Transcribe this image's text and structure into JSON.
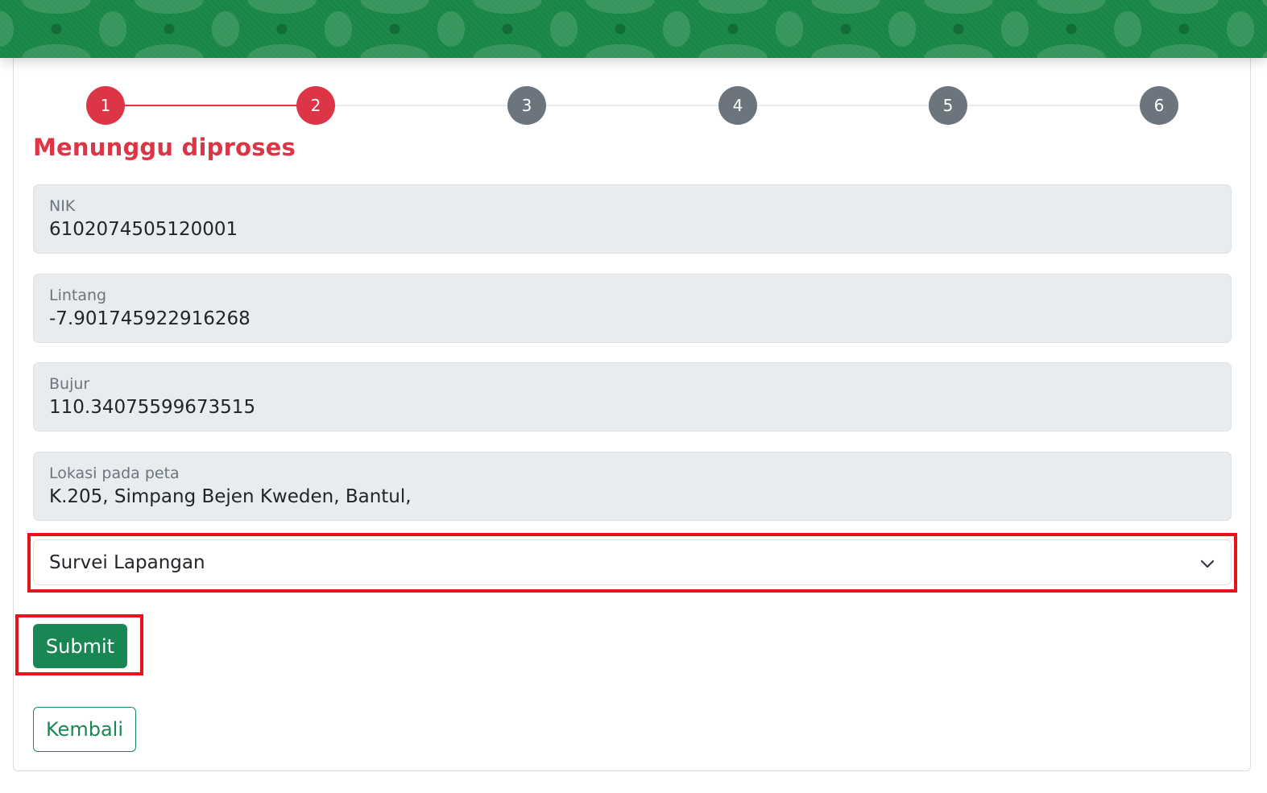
{
  "stepper": {
    "steps": [
      {
        "label": "1",
        "state": "active"
      },
      {
        "label": "2",
        "state": "active"
      },
      {
        "label": "3",
        "state": "inactive"
      },
      {
        "label": "4",
        "state": "inactive"
      },
      {
        "label": "5",
        "state": "inactive"
      },
      {
        "label": "6",
        "state": "inactive"
      }
    ],
    "active_color": "#dc3545",
    "inactive_color": "#6c757d"
  },
  "status_title": "Menunggu diproses",
  "fields": {
    "nik": {
      "label": "NIK",
      "value": "6102074505120001"
    },
    "lintang": {
      "label": "Lintang",
      "value": "-7.901745922916268"
    },
    "bujur": {
      "label": "Bujur",
      "value": "110.34075599673515"
    },
    "lokasi": {
      "label": "Lokasi pada peta",
      "value": "K.205, Simpang Bejen Kweden, Bantul,"
    }
  },
  "status_select": {
    "selected": "Survei Lapangan",
    "icon": "chevron-down-icon"
  },
  "actions": {
    "submit_label": "Submit",
    "back_label": "Kembali"
  },
  "colors": {
    "brand_green": "#198754",
    "highlight_red": "#e3151b"
  }
}
